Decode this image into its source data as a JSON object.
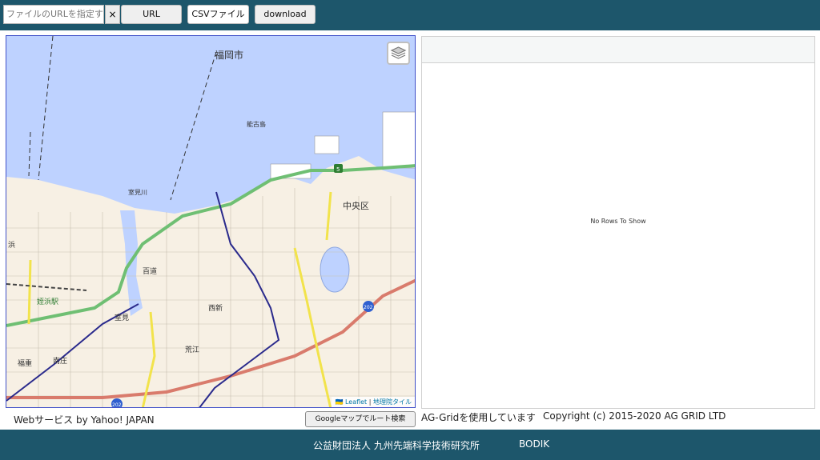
{
  "toolbar": {
    "url_placeholder": "ファイルのURLを指定する",
    "clear_label": "×",
    "url_button": "URL",
    "csv_button": "CSVファイル",
    "download_button": "download"
  },
  "map": {
    "labels": {
      "city": "福岡市",
      "island": "能古島",
      "ward": "中央区",
      "river": "室見川",
      "momochi": "百道",
      "nishijin": "西新",
      "muromi": "室見",
      "arae": "荒江",
      "nanso": "南庄",
      "fukushige": "福重",
      "station": "姪浜駅",
      "route_202_a": "202",
      "route_202_b": "202",
      "expressway_marker": "5",
      "edge_left": "浜"
    },
    "attribution": {
      "flag": "🇺🇦",
      "leaflet": "Leaflet",
      "separator": "|",
      "tiles": "地理院タイル"
    }
  },
  "grid": {
    "empty_message": "No Rows To Show"
  },
  "credits": {
    "yahoo": "Webサービス by Yahoo! JAPAN",
    "route_button": "Googleマップでルート検索",
    "aggrid": "AG-Gridを使用しています",
    "copyright": "Copyright (c) 2015-2020 AG GRID LTD"
  },
  "footer": {
    "organization": "公益財団法人 九州先端科学技術研究所",
    "bodik": "BODIK"
  },
  "colors": {
    "header_bg": "#1d566b",
    "sea": "#bed2ff",
    "land": "#f7f0e4",
    "expressway": "#6fbf73",
    "national_road": "#d97b6c",
    "prefectural_road": "#f2e34c",
    "railway": "#2a2a8c"
  }
}
